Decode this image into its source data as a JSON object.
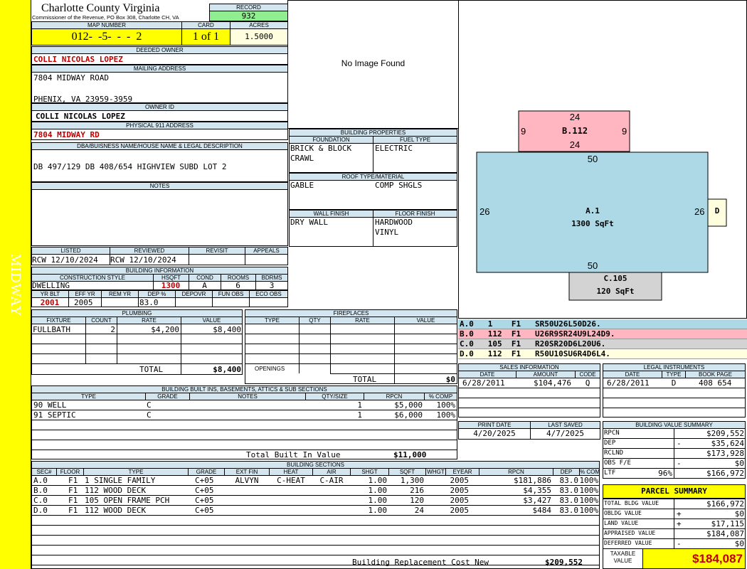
{
  "side_label": "MIDWAY",
  "header": {
    "county": "Charlotte County Virginia",
    "commissioner": "Commissioner of the Revenue, PO Box 308, Charlotte CH, VA",
    "record_label": "RECORD",
    "record": "932",
    "map_label": "MAP NUMBER",
    "map_number": "012-  -5-  -  -  2",
    "card_label": "CARD",
    "card": "1 of 1",
    "acres_label": "ACRES",
    "acres": "1.5000"
  },
  "owner": {
    "deeded_label": "DEEDED OWNER",
    "deeded": "COLLI NICOLAS LOPEZ",
    "mailing_label": "MAILING ADDRESS",
    "mail_line1": "7804 MIDWAY ROAD",
    "mail_line2": "PHENIX, VA 23959-3959",
    "owner_id_label": "OWNER ID",
    "owner_id": "COLLI NICOLAS LOPEZ",
    "physical_label": "PHYSICAL 911 ADDRESS",
    "physical": "7804 MIDWAY RD",
    "dba_label": "DBA/BUISNESS NAME/HOUSE NAME & LEGAL DESCRIPTION",
    "legal": "DB 497/129 DB 408/654 HIGHVIEW SUBD LOT 2",
    "notes_label": "NOTES"
  },
  "image_placeholder": "No Image Found",
  "building_properties": {
    "title": "BUILDING PROPERTIES",
    "foundation_label": "FOUNDATION",
    "fuel_label": "FUEL TYPE",
    "foundation1": "BRICK & BLOCK",
    "foundation2": "CRAWL",
    "fuel": "ELECTRIC",
    "roof_label": "ROOF TYPE/MATERIAL",
    "roof_type": "GABLE",
    "roof_material": "COMP SHGLS",
    "wall_label": "WALL FINISH",
    "floor_label": "FLOOR FINISH",
    "wall": "DRY WALL",
    "floor1": "HARDWOOD",
    "floor2": "VINYL"
  },
  "review": {
    "listed_label": "LISTED",
    "reviewed_label": "REVIEWED",
    "revisit_label": "REVISIT",
    "appeals_label": "APPEALS",
    "listed": "RCW 12/10/2024",
    "reviewed": "RCW 12/10/2024"
  },
  "building_info": {
    "title": "BUILDING INFORMATION",
    "style_label": "CONSTRUCTION STYLE",
    "hsqft_label": "HSQFT",
    "cond_label": "COND",
    "rooms_label": "ROOMS",
    "bdrms_label": "BDRMS",
    "style": "DWELLING",
    "hsqft": "1300",
    "cond": "A",
    "rooms": "6",
    "bdrms": "3",
    "yrblt_label": "YR BLT",
    "effyr_label": "EFF YR",
    "remyr_label": "REM YR",
    "dep_label": "DEP %",
    "depovr_label": "DEPOVR",
    "funobs_label": "FUN OBS",
    "ecoobs_label": "ECO OBS",
    "yrblt": "2001",
    "effyr": "2005",
    "dep": "83.0"
  },
  "plumbing": {
    "title": "PLUMBING",
    "cols": [
      "FIXTURE",
      "COUNT",
      "RATE",
      "VALUE"
    ],
    "row": {
      "fixture": "FULLBATH",
      "count": "2",
      "rate": "$4,200",
      "value": "$8,400"
    },
    "total_label": "TOTAL",
    "total": "$8,400"
  },
  "fireplaces": {
    "title": "FIREPLACES",
    "cols": [
      "TYPE",
      "QTY",
      "RATE",
      "VALUE"
    ],
    "openings_label": "OPENINGS",
    "total_label": "TOTAL",
    "total": "$0"
  },
  "builtins": {
    "title": "BUILDING BUILT INS, BASEMENTS, ATTICS & SUB SECTIONS",
    "cols": [
      "TYPE",
      "GRADE",
      "NOTES",
      "QTY/SIZE",
      "RPCN",
      "% COMP"
    ],
    "rows": [
      {
        "type": "90 WELL",
        "grade": "C",
        "qty": "1",
        "rpcn": "$5,000",
        "comp": "100%"
      },
      {
        "type": "91 SEPTIC",
        "grade": "C",
        "qty": "1",
        "rpcn": "$6,000",
        "comp": "100%"
      }
    ],
    "total_label": "Total Built In Value",
    "total": "$11,000"
  },
  "sections": {
    "title": "BUILDING SECTIONS",
    "cols": [
      "SEC#",
      "FLOOR",
      "TYPE",
      "GRADE",
      "EXT FIN",
      "HEAT",
      "AIR",
      "SHGT",
      "SQFT",
      "WHGT",
      "EYEAR",
      "RPCN",
      "DEP",
      "% COMP"
    ],
    "rows": [
      {
        "sec": "A.0",
        "floor": "F1",
        "type": "1 SINGLE FAMILY",
        "grade": "C+05",
        "ext": "ALVYN",
        "heat": "C-HEAT",
        "air": "C-AIR",
        "shgt": "1.00",
        "sqft": "1,300",
        "eyear": "2005",
        "rpcn": "$181,886",
        "dep": "83.0",
        "comp": "100%"
      },
      {
        "sec": "B.0",
        "floor": "F1",
        "type": "112 WOOD DECK",
        "grade": "C+05",
        "ext": "",
        "heat": "",
        "air": "",
        "shgt": "1.00",
        "sqft": "216",
        "eyear": "2005",
        "rpcn": "$4,355",
        "dep": "83.0",
        "comp": "100%"
      },
      {
        "sec": "C.0",
        "floor": "F1",
        "type": "105 OPEN FRAME PCH",
        "grade": "C+05",
        "ext": "",
        "heat": "",
        "air": "",
        "shgt": "1.00",
        "sqft": "120",
        "eyear": "2005",
        "rpcn": "$3,427",
        "dep": "83.0",
        "comp": "100%"
      },
      {
        "sec": "D.0",
        "floor": "F1",
        "type": "112 WOOD DECK",
        "grade": "C+05",
        "ext": "",
        "heat": "",
        "air": "",
        "shgt": "1.00",
        "sqft": "24",
        "eyear": "2005",
        "rpcn": "$484",
        "dep": "83.0",
        "comp": "100%"
      }
    ],
    "total_label": "Building Replacement Cost New",
    "total": "$209,552"
  },
  "sketch": {
    "a_label": "A.1",
    "a_sqft": "1300 SqFt",
    "a_top": "50",
    "a_bottom": "50",
    "a_left": "26",
    "a_right": "26",
    "b_label": "B.112",
    "b_top": "24",
    "b_bottom": "24",
    "b_left": "9",
    "b_right": "9",
    "c_label": "C.105",
    "c_sqft": "120 SqFt",
    "d_label": "D",
    "legend": [
      {
        "code": "A.0   1    F1   SR50U26L50D26.",
        "color": "#add8e6"
      },
      {
        "code": "B.0   112  F1   U26R9SR24U9L24D9.",
        "color": "#ffb6c1"
      },
      {
        "code": "C.0   105  F1   R20SR20D6L20U6.",
        "color": "#d3d3d3"
      },
      {
        "code": "D.0   112  F1   R50U10SU6R4D6L4.",
        "color": "#ffffe0"
      }
    ]
  },
  "sales": {
    "title": "SALES INFORMATION",
    "cols": [
      "DATE",
      "AMOUNT",
      "CODE"
    ],
    "row": {
      "date": "6/28/2011",
      "amount": "$104,476",
      "code": "Q"
    }
  },
  "legal_instruments": {
    "title": "LEGAL INSTRUMENTS",
    "cols": [
      "DATE",
      "TYPE",
      "BOOK PAGE"
    ],
    "row": {
      "date": "6/28/2011",
      "type": "D",
      "book": "408 654"
    }
  },
  "dates": {
    "print_label": "PRINT DATE",
    "saved_label": "LAST SAVED",
    "print": "4/20/2025",
    "saved": "4/7/2025"
  },
  "value_summary": {
    "title": "BUILDING VALUE SUMMARY",
    "rows": [
      {
        "label": "RPCN",
        "sign": "",
        "value": "$209,552"
      },
      {
        "label": "DEP",
        "sign": "-",
        "value": "$35,624"
      },
      {
        "label": "RCLND",
        "sign": "",
        "value": "$173,928"
      },
      {
        "label": "OBS F/E",
        "sign": "-",
        "value": "$0"
      },
      {
        "label": "LTF",
        "sign": "96%",
        "value": "$166,972"
      }
    ]
  },
  "parcel": {
    "title": "PARCEL SUMMARY",
    "rows": [
      {
        "label": "TOTAL BLDG VALUE",
        "sign": "",
        "value": "$166,972"
      },
      {
        "label": "OBLDG VALUE",
        "sign": "+",
        "value": "$0"
      },
      {
        "label": "LAND VALUE",
        "sign": "+",
        "value": "$17,115"
      },
      {
        "label": "APPRAISED VALUE",
        "sign": "",
        "value": "$184,087"
      },
      {
        "label": "DEFERRED VALUE",
        "sign": "-",
        "value": "$0"
      }
    ],
    "taxable_label1": "TAXABLE",
    "taxable_label2": "VALUE",
    "taxable": "$184,087"
  }
}
